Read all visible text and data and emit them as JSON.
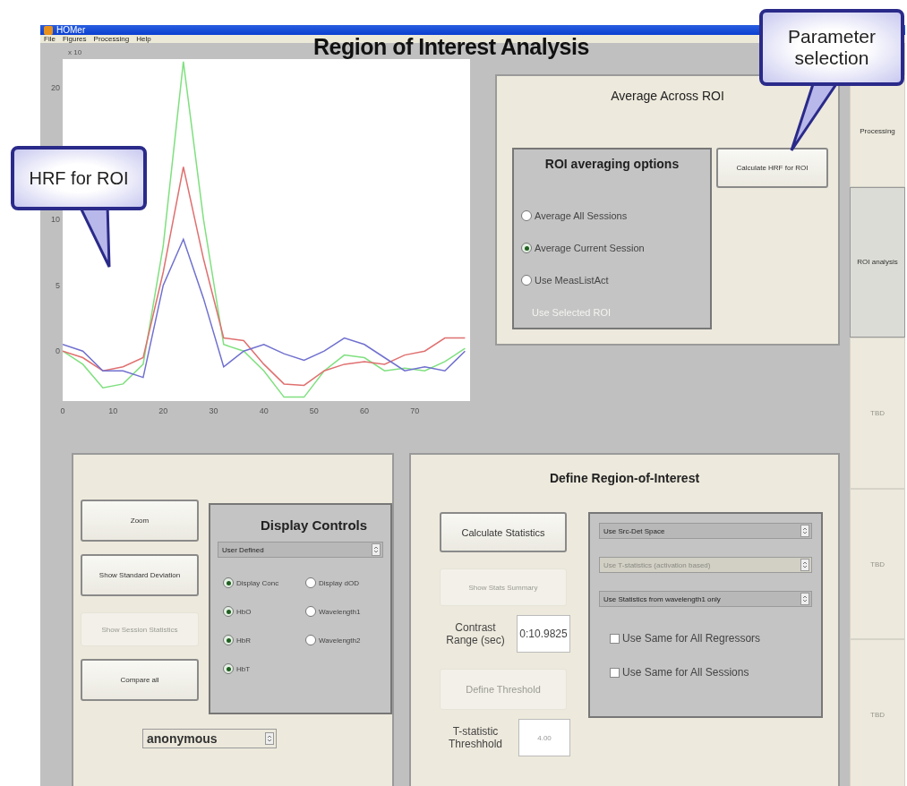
{
  "window": {
    "title": "HOMer"
  },
  "menu": [
    "File",
    "Figures",
    "Processing",
    "Help"
  ],
  "page_title": "Region of Interest Analysis",
  "chart": {
    "chart_data": {
      "type": "line",
      "x": [
        0,
        4,
        8,
        12,
        16,
        20,
        24,
        28,
        32,
        36,
        40,
        44,
        48,
        52,
        56,
        60,
        64,
        68,
        72,
        76,
        80
      ],
      "series": [
        {
          "color": "#7fe07f",
          "values": [
            0,
            -1,
            -2.8,
            -2.5,
            -1,
            8,
            22,
            10,
            0.5,
            0,
            -1.5,
            -3.5,
            -3.5,
            -1.5,
            -0.3,
            -0.5,
            -1.5,
            -1.3,
            -1.5,
            -0.8,
            0.2
          ]
        },
        {
          "color": "#e07070",
          "values": [
            0,
            -0.5,
            -1.5,
            -1.2,
            -0.5,
            6,
            14,
            7,
            1,
            0.8,
            -1,
            -2.5,
            -2.6,
            -1.5,
            -1,
            -0.8,
            -1,
            -0.3,
            0,
            1,
            1
          ]
        },
        {
          "color": "#7070d0",
          "values": [
            0.5,
            0,
            -1.5,
            -1.5,
            -2,
            5,
            8.5,
            4,
            -1.2,
            0,
            0.5,
            -0.2,
            -0.7,
            0,
            1,
            0.5,
            -0.5,
            -1.5,
            -1.2,
            -1.5,
            0
          ]
        }
      ],
      "xlim": [
        0,
        81
      ],
      "ylim": [
        -3.8,
        22.2
      ],
      "xticks": [
        0,
        10,
        20,
        30,
        40,
        50,
        60,
        70
      ],
      "yticks": [
        0,
        5,
        10,
        20
      ],
      "annotations": [
        "x 10"
      ]
    }
  },
  "average_panel": {
    "title": "Average Across ROI",
    "options": {
      "title": "ROI averaging options",
      "radios": [
        {
          "label": "Average All Sessions",
          "selected": false,
          "disabled": false
        },
        {
          "label": "Average Current Session",
          "selected": true,
          "disabled": false
        },
        {
          "label": "Use MeasListAct",
          "selected": false,
          "disabled": false
        }
      ],
      "disabled_option": "Use Selected ROI"
    },
    "button": "Calculate HRF for ROI"
  },
  "display_panel": {
    "buttons": [
      {
        "label": "Zoom",
        "disabled": false
      },
      {
        "label": "Show Standard Deviation",
        "disabled": false
      },
      {
        "label": "Show Session Statistics",
        "disabled": true
      },
      {
        "label": "Compare all",
        "disabled": false
      }
    ],
    "controls": {
      "title": "Display Controls",
      "dropdown": "User Defined",
      "radios": [
        {
          "label": "Display Conc",
          "selected": true
        },
        {
          "label": "Display dOD",
          "selected": false
        },
        {
          "label": "HbO",
          "selected": true
        },
        {
          "label": "Wavelength1",
          "selected": false
        },
        {
          "label": "HbR",
          "selected": true
        },
        {
          "label": "Wavelength2",
          "selected": false
        },
        {
          "label": "HbT",
          "selected": true
        }
      ]
    },
    "subject_dropdown": "anonymous"
  },
  "roi_panel": {
    "title": "Define Region-of-Interest",
    "calculate_button": {
      "label": "Calculate Statistics",
      "disabled": false
    },
    "summary_button": {
      "label": "Show Stats Summary",
      "disabled": true
    },
    "contrast": {
      "label": "Contrast Range (sec)",
      "value": "0:10.9825"
    },
    "threshold_button": {
      "label": "Define Threshold",
      "disabled": true
    },
    "threshold": {
      "label": "T-statistic Threshhold",
      "placeholder": "4.00"
    },
    "dropdowns": [
      {
        "value": "Use Src-Det Space",
        "disabled": false
      },
      {
        "value": "Use T-statistics (activation based)",
        "disabled": true
      },
      {
        "value": "Use Statistics from wavelength1 only",
        "disabled": false
      }
    ],
    "checkboxes": [
      {
        "label": "Use Same for All Regressors",
        "checked": false
      },
      {
        "label": "Use Same for All Sessions",
        "checked": false
      }
    ]
  },
  "side_tabs": [
    {
      "label": "Processing",
      "selected": false,
      "disabled": false
    },
    {
      "label": "ROI analysis",
      "selected": true,
      "disabled": false
    },
    {
      "label": "TBD",
      "selected": false,
      "disabled": true
    },
    {
      "label": "TBD",
      "selected": false,
      "disabled": true
    },
    {
      "label": "TBD",
      "selected": false,
      "disabled": true
    }
  ],
  "callouts": [
    {
      "text": "HRF for ROI"
    },
    {
      "text": "Parameter selection"
    }
  ]
}
